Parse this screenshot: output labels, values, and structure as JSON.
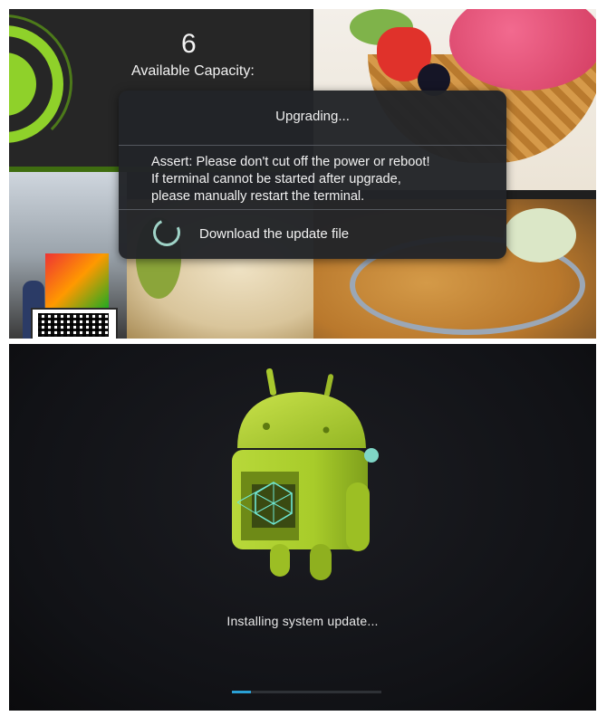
{
  "capacity": {
    "value": "6",
    "label": "Available Capacity:"
  },
  "dialog": {
    "title": "Upgrading...",
    "message_lines": [
      "Assert: Please don't cut off the power or reboot!",
      "If terminal cannot be started after upgrade,",
      "please manually restart the terminal."
    ],
    "status_icon": "loading-spinner-icon",
    "status_text": "Download the update file"
  },
  "install": {
    "robot_icon": "android-robot-icon",
    "status_text": "Installing system update...",
    "progress": 0.13
  },
  "colors": {
    "accent_green": "#8fd12a",
    "spinner": "#9fd3c7",
    "progress": "#2aa0d4"
  }
}
